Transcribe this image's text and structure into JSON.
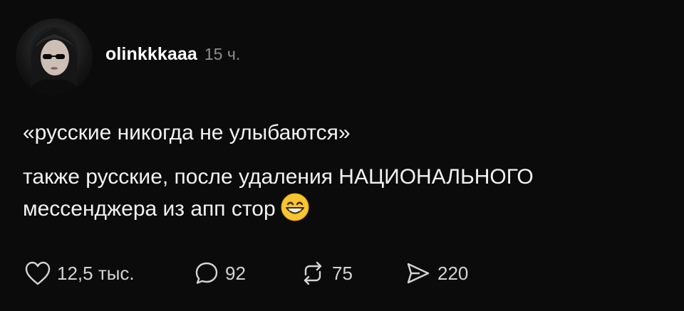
{
  "post": {
    "username": "olinkkkaaa",
    "time": "15 ч.",
    "text_line1": "«русские никогда не улыбаются»",
    "text_line2": "также русские, после удаления НАЦИОНАЛЬНОГО мессенджера из апп стор",
    "emoji": "grinning-face-with-smiling-eyes"
  },
  "actions": {
    "likes": "12,5 тыс.",
    "comments": "92",
    "reposts": "75",
    "shares": "220"
  },
  "colors": {
    "background": "#0b0b0b",
    "text": "#f2f2f2",
    "muted": "#8e8e8e",
    "emoji": "#f7c531"
  }
}
